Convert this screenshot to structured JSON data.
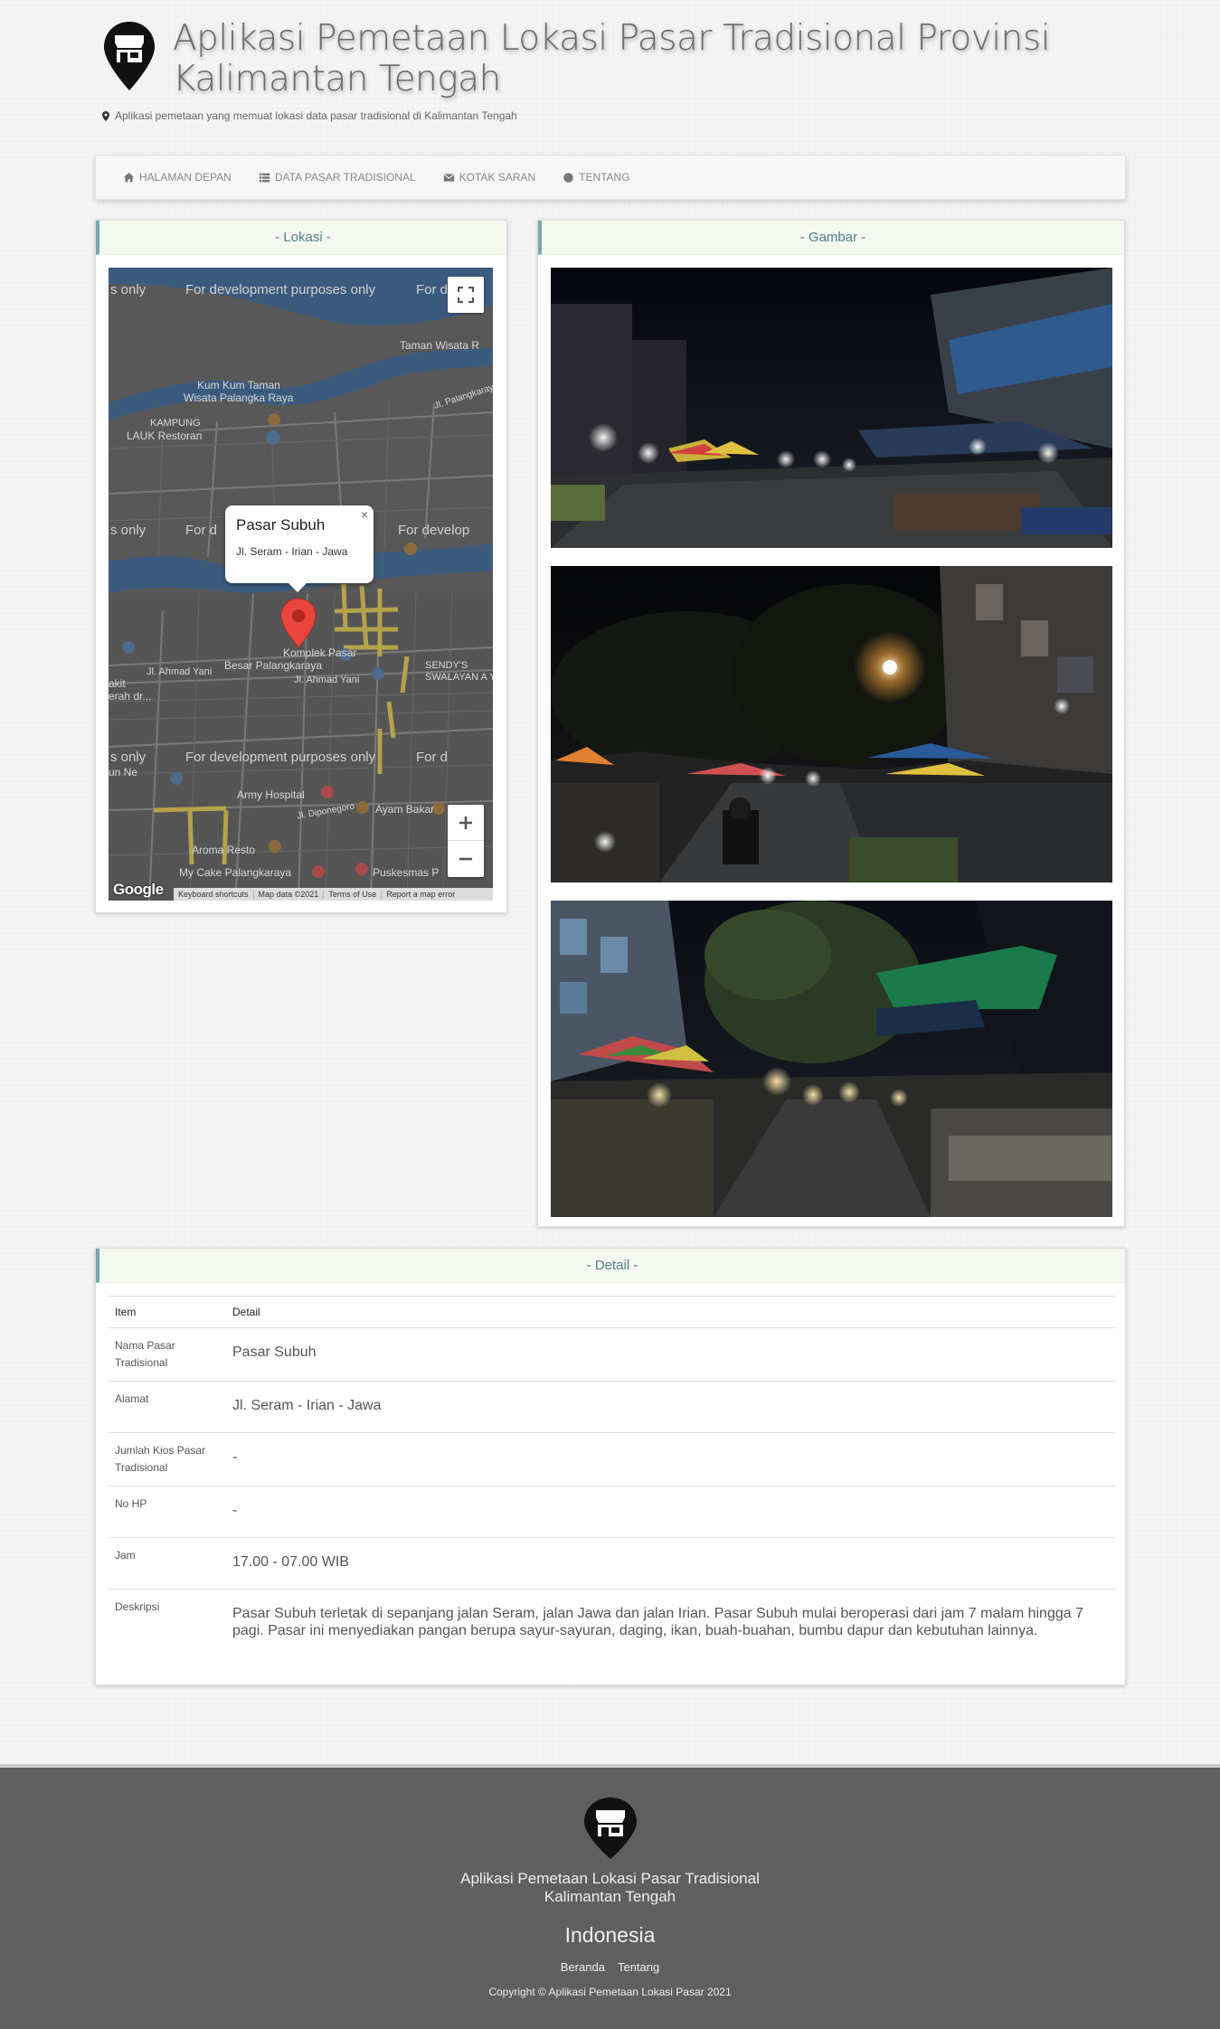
{
  "header": {
    "title": "Aplikasi Pemetaan Lokasi Pasar Tradisional Provinsi Kalimantan Tengah",
    "subtitle": "Aplikasi pemetaan yang memuat lokasi data pasar tradisional di Kalimantan Tengah",
    "logo_icon": "map-pin-market-icon"
  },
  "nav": {
    "items": [
      {
        "label": "HALAMAN DEPAN",
        "icon": "home-icon"
      },
      {
        "label": "DATA PASAR TRADISIONAL",
        "icon": "list-icon"
      },
      {
        "label": "KOTAK SARAN",
        "icon": "envelope-icon"
      },
      {
        "label": "TENTANG",
        "icon": "circle-icon"
      }
    ]
  },
  "lokasi": {
    "title": "- Lokasi -",
    "map": {
      "dev_watermark": "For development purposes only",
      "dev_watermark_partial_left": "s only",
      "dev_watermark_partial_right": "For d",
      "dev_watermark_partial_right2": "For develop",
      "labels": {
        "taman": "Taman Wisata R",
        "kumkum1": "Kum Kum Taman",
        "kumkum2": "Wisata Palangka Raya",
        "kampung1": "KAMPUNG",
        "kampung2": "LAUK Restoran",
        "road_palangkaraya": "Jl. Palangkaraya-Bunt",
        "jl_ahmad_yani": "Jl. Ahmad Yani",
        "jl_ahmad_yani2": "Jl. Ahmad Yani",
        "komplek1": "Komplek Pasar",
        "komplek2": "Besar Palangkaraya",
        "sendys1": "SENDY'S",
        "sendys2": "SWALAYAN A YAN",
        "army": "Army Hospital",
        "diponegoro": "Jl. Diponegoro",
        "ayam_bakar": "Ayam Bakar",
        "aroma": "Aroma Resto",
        "mycake": "My Cake Palangkaraya",
        "puskesmas": "Puskesmas P",
        "left_kit": "akit",
        "left_erah": "erah dr...",
        "left_ne": "un Ne"
      },
      "popup": {
        "title": "Pasar Subuh",
        "address": "Jl. Seram - Irian - Jawa"
      },
      "footer": [
        "Keyboard shortcuts",
        "Map data ©2021",
        "Terms of Use",
        "Report a map error"
      ],
      "google_logo": "Google"
    }
  },
  "gambar": {
    "title": "- Gambar -"
  },
  "detail": {
    "title": "- Detail -",
    "headers": [
      "Item",
      "Detail"
    ],
    "rows": [
      {
        "item": "Nama Pasar Tradisional",
        "detail": "Pasar Subuh"
      },
      {
        "item": "Alamat",
        "detail": "Jl. Seram - Irian - Jawa"
      },
      {
        "item": "Jumlah Kios Pasar Tradisional",
        "detail": "-"
      },
      {
        "item": "No HP",
        "detail": "-"
      },
      {
        "item": "Jam",
        "detail": "17.00 - 07.00 WIB"
      },
      {
        "item": "Deskripsi",
        "detail": "Pasar Subuh terletak di sepanjang jalan Seram, jalan Jawa dan jalan Irian. Pasar Subuh mulai beroperasi dari jam 7 malam hingga 7 pagi. Pasar ini menyediakan pangan berupa sayur-sayuran, daging, ikan, buah-buahan, bumbu dapur dan kebutuhan lainnya."
      }
    ]
  },
  "footer": {
    "title_line1": "Aplikasi Pemetaan Lokasi Pasar Tradisional",
    "title_line2": "Kalimantan Tengah",
    "country": "Indonesia",
    "links": [
      "Beranda",
      "Tentang"
    ],
    "copyright": "Copyright © Aplikasi Pemetaan Lokasi Pasar 2021"
  }
}
